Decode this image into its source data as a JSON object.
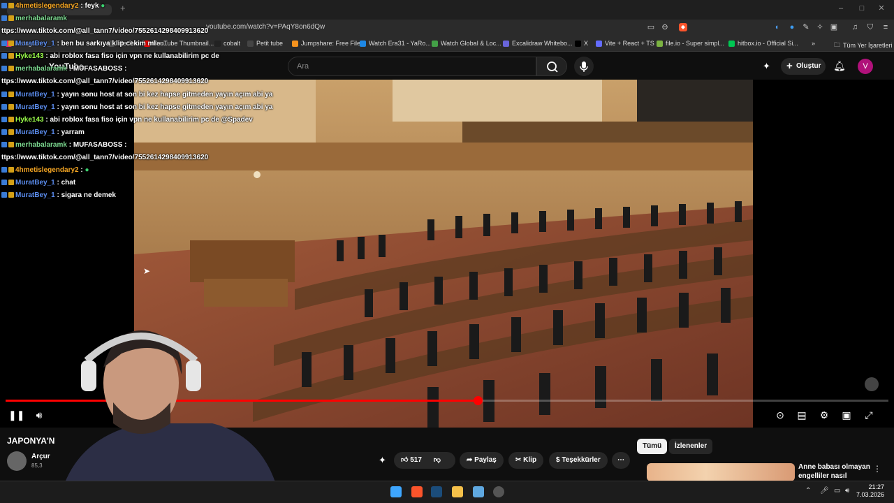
{
  "browser": {
    "url": "youtube.com/watch?v=PAqY8on6dQw",
    "bookmarks": [
      {
        "label": "Instagram",
        "color": "#e1306c"
      },
      {
        "label": "Yle Suo Suoisen...",
        "color": "#555"
      },
      {
        "label": "YouTube Thumbnail...",
        "color": "#ff0000"
      },
      {
        "label": "cobalt",
        "color": "#222"
      },
      {
        "label": "Petit tube",
        "color": "#444"
      },
      {
        "label": "Jumpshare: Free File...",
        "color": "#f7931e"
      },
      {
        "label": "Watch Era31 - YaRo...",
        "color": "#1e88e5"
      },
      {
        "label": "Watch Global & Loc...",
        "color": "#43a047"
      },
      {
        "label": "Excalidraw Whitebo...",
        "color": "#6965db"
      },
      {
        "label": "X",
        "color": "#000"
      },
      {
        "label": "Vite + React + TS",
        "color": "#646cff"
      },
      {
        "label": "file.io - Super simpl...",
        "color": "#7cb342"
      },
      {
        "label": "hitbox.io - Official Si...",
        "color": "#00c853"
      }
    ],
    "all_bookmarks_label": "Tüm Yer İşaretleri"
  },
  "youtube": {
    "logo": "YouTube",
    "search_placeholder": "Ara",
    "create_label": "Oluştur",
    "avatar_letter": "V"
  },
  "video": {
    "progress": 0.535,
    "title": "JAPONYA'N",
    "channel": "Arçur",
    "subs": "85,3",
    "likes": "517",
    "share_label": "Paylaş",
    "clip_label": "Klip",
    "thanks_label": "Teşekkürler",
    "filter_all": "Tümü",
    "filter_watched": "İzlenenler",
    "rec_title": "Anne babası olmayan engelliler nasıl yaşıyor..."
  },
  "chat": [
    {
      "user": "4hmetislegendary2",
      "msg": ": feyk",
      "color": "#f5a623"
    },
    {
      "user": "merhabalaramk",
      "msg": "",
      "color": "#7bd88f"
    },
    {
      "user": "",
      "msg": "ttps://www.tiktok.com/@all_tann7/video/7552614298409913620",
      "color": "#fff"
    },
    {
      "user": "MuratBey_1",
      "msg": ": ben bu sarkıya klip cekim ml",
      "color": "#5b8def"
    },
    {
      "user": "Hyke143",
      "msg": ": abi roblox fasa fiso için vpn ne kullanabilirim pc de",
      "color": "#9bff4a"
    },
    {
      "user": "merhabalaramk",
      "msg": ": MUFASABOSS :",
      "color": "#7bd88f"
    },
    {
      "user": "",
      "msg": "ttps://www.tiktok.com/@all_tann7/video/7552614298409913620",
      "color": "#fff"
    },
    {
      "user": "MuratBey_1",
      "msg": ": yayın sonu host at son bi kez hapse gitmeden yayın açım abi ya",
      "color": "#5b8def"
    },
    {
      "user": "MuratBey_1",
      "msg": ": yayın sonu host at son bi kez hapse gitmeden yayın açım abi ya",
      "color": "#5b8def"
    },
    {
      "user": "Hyke143",
      "msg": ": abi roblox fasa fiso için vpn ne kullanabilirim pc de @Spadev",
      "color": "#9bff4a"
    },
    {
      "user": "MuratBey_1",
      "msg": ": yarram",
      "color": "#5b8def"
    },
    {
      "user": "merhabalaramk",
      "msg": ": MUFASABOSS :",
      "color": "#7bd88f"
    },
    {
      "user": "",
      "msg": "ttps://www.tiktok.com/@all_tann7/video/7552614298409913620",
      "color": "#fff"
    },
    {
      "user": "4hmetislegendary2",
      "msg": ":",
      "color": "#f5a623"
    },
    {
      "user": "MuratBey_1",
      "msg": ": chat",
      "color": "#5b8def"
    },
    {
      "user": "MuratBey_1",
      "msg": ": sigara ne demek",
      "color": "#5b8def"
    }
  ],
  "taskbar": {
    "time": "21:27",
    "date": "7.03.2026"
  }
}
